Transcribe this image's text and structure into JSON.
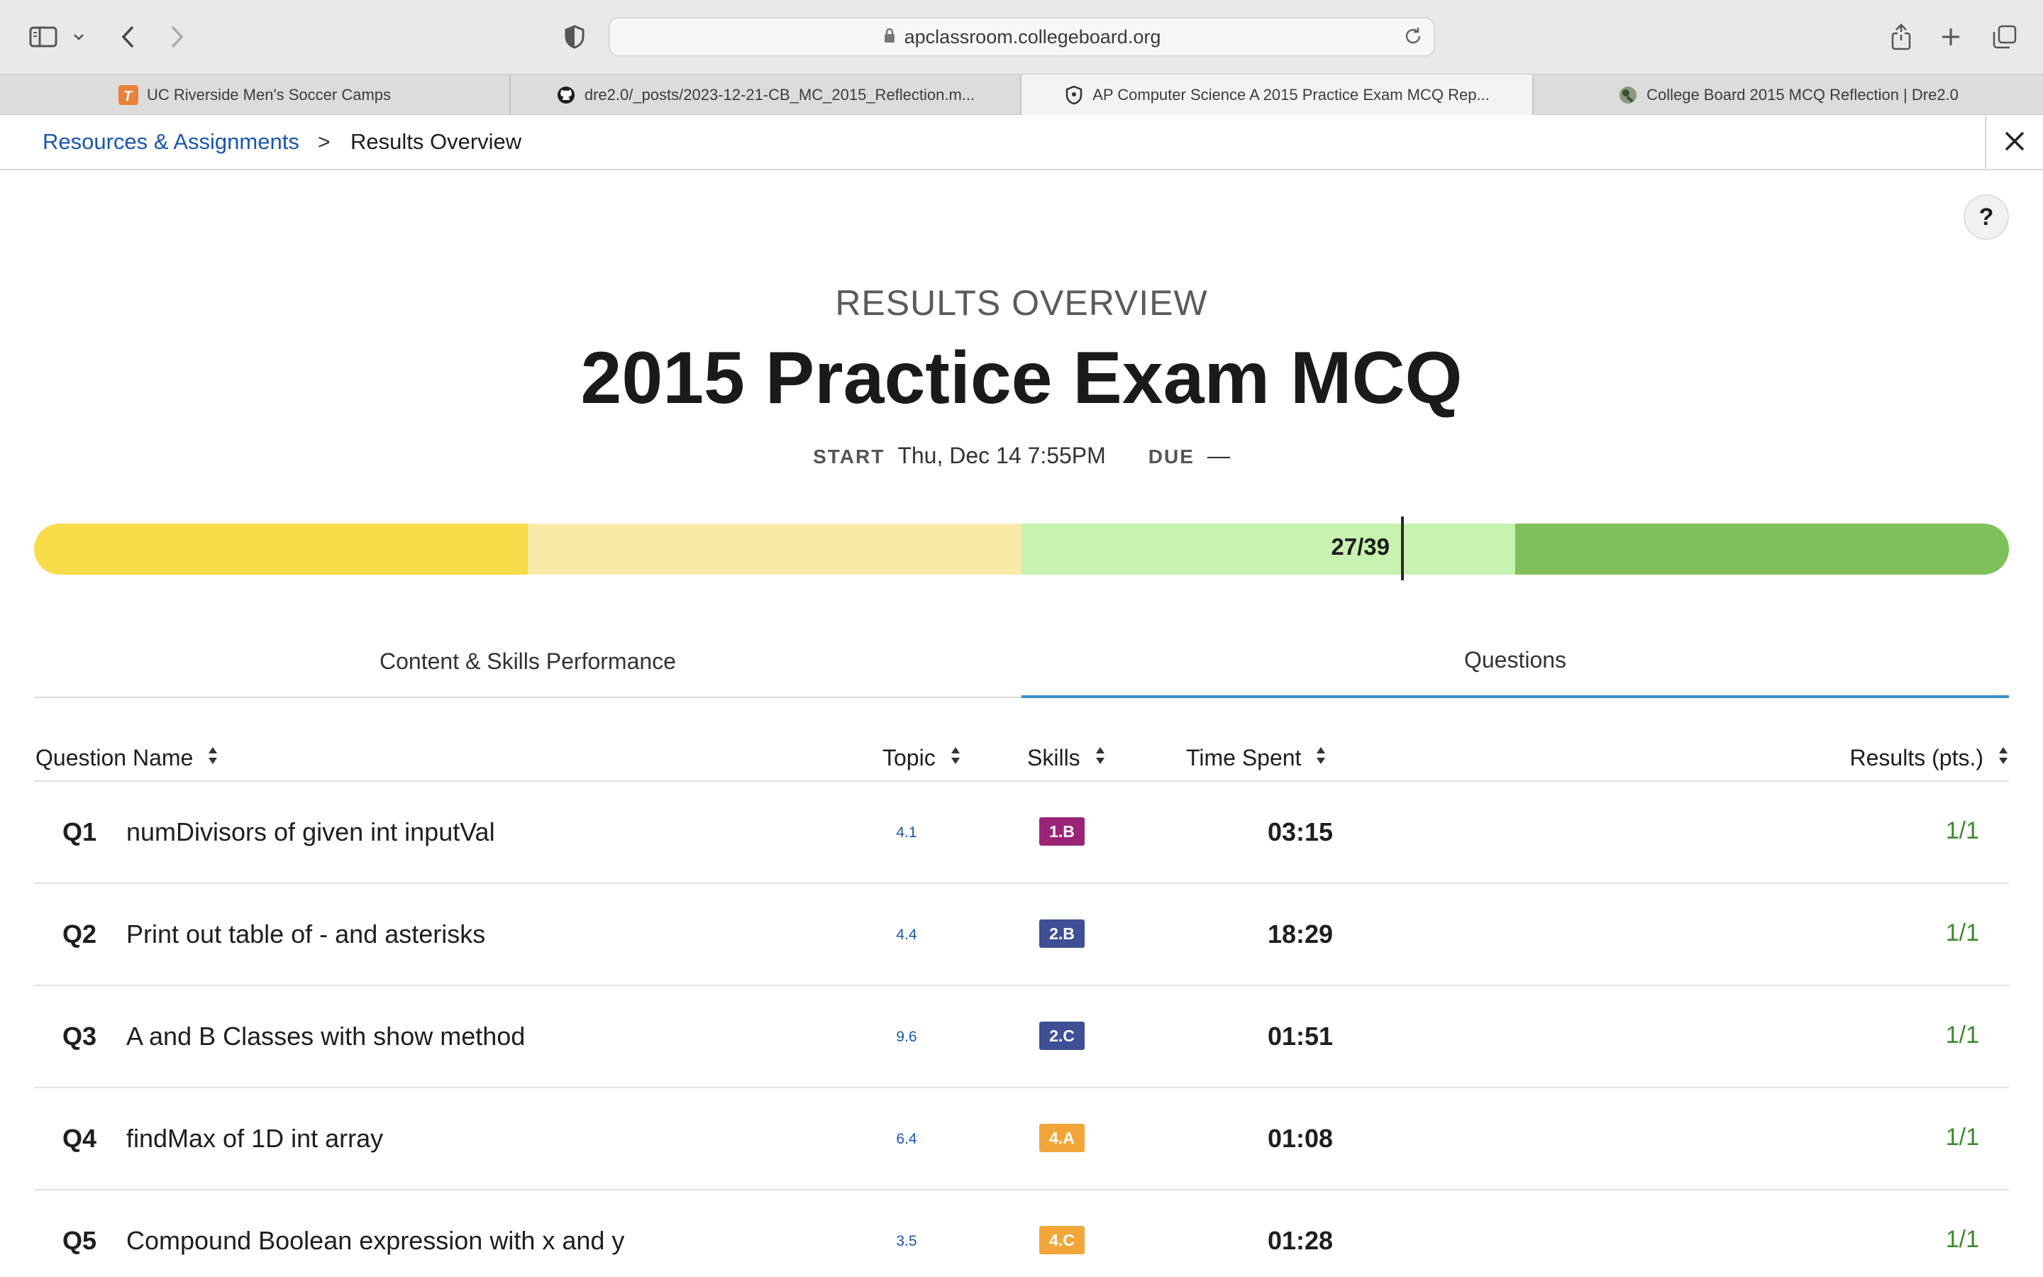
{
  "browser": {
    "url": "apclassroom.collegeboard.org",
    "icons": [
      "sidebar-icon",
      "chevron-down-icon",
      "back-icon",
      "forward-icon",
      "shield-icon",
      "lock-icon",
      "reload-icon",
      "share-icon",
      "new-tab-icon",
      "tabs-overview-icon"
    ]
  },
  "tabs": [
    {
      "label": "UC Riverside Men's Soccer Camps",
      "icon": "t-logo-icon",
      "active": false
    },
    {
      "label": "dre2.0/_posts/2023-12-21-CB_MC_2015_Reflection.m...",
      "icon": "github-icon",
      "active": false
    },
    {
      "label": "AP Computer Science A 2015 Practice Exam MCQ Rep...",
      "icon": "shield-icon",
      "active": true
    },
    {
      "label": "College Board 2015 MCQ Reflection | Dre2.0",
      "icon": "site-icon",
      "active": false
    }
  ],
  "breadcrumb": {
    "link": "Resources & Assignments",
    "separator": ">",
    "current": "Results Overview"
  },
  "help_label": "?",
  "header": {
    "subtitle": "RESULTS OVERVIEW",
    "title": "2015 Practice Exam MCQ",
    "start_label": "START",
    "start_value": "Thu, Dec 14 7:55PM",
    "due_label": "DUE",
    "due_value": "—"
  },
  "score": {
    "label": "27/39",
    "correct": 27,
    "total": 39,
    "band_colors": [
      "#f8dc4a",
      "#faeaa8",
      "#c8f2b0",
      "#80c05a"
    ]
  },
  "page_tabs": {
    "content": "Content & Skills Performance",
    "questions": "Questions",
    "active": "questions"
  },
  "table": {
    "headers": {
      "name": "Question Name",
      "topic": "Topic",
      "skills": "Skills",
      "time": "Time Spent",
      "results": "Results (pts.)"
    },
    "rows": [
      {
        "num": "Q1",
        "name": "numDivisors of given int inputVal",
        "topic": "4.1",
        "skill": "1.B",
        "skill_color": "#9b2377",
        "time": "03:15",
        "result": "1/1"
      },
      {
        "num": "Q2",
        "name": "Print out table of - and asterisks",
        "topic": "4.4",
        "skill": "2.B",
        "skill_color": "#3e4f95",
        "time": "18:29",
        "result": "1/1"
      },
      {
        "num": "Q3",
        "name": "A and B Classes with show method",
        "topic": "9.6",
        "skill": "2.C",
        "skill_color": "#3e4f95",
        "time": "01:51",
        "result": "1/1"
      },
      {
        "num": "Q4",
        "name": "findMax of 1D int array",
        "topic": "6.4",
        "skill": "4.A",
        "skill_color": "#f2a63a",
        "time": "01:08",
        "result": "1/1"
      },
      {
        "num": "Q5",
        "name": "Compound Boolean expression with x and y",
        "topic": "3.5",
        "skill": "4.C",
        "skill_color": "#f2a63a",
        "time": "01:28",
        "result": "1/1"
      }
    ]
  }
}
